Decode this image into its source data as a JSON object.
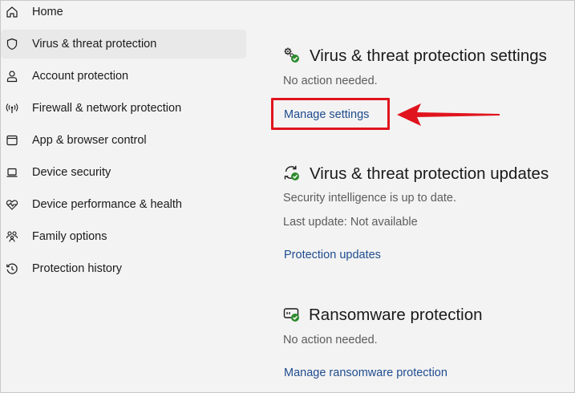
{
  "sidebar": {
    "items": [
      {
        "label": "Home",
        "icon": "home-icon"
      },
      {
        "label": "Virus & threat protection",
        "icon": "shield-icon",
        "selected": true
      },
      {
        "label": "Account protection",
        "icon": "person-icon"
      },
      {
        "label": "Firewall & network protection",
        "icon": "antenna-icon"
      },
      {
        "label": "App & browser control",
        "icon": "app-window-icon"
      },
      {
        "label": "Device security",
        "icon": "laptop-icon"
      },
      {
        "label": "Device performance & health",
        "icon": "heartbeat-icon"
      },
      {
        "label": "Family options",
        "icon": "family-icon"
      },
      {
        "label": "Protection history",
        "icon": "history-icon"
      }
    ]
  },
  "main": {
    "settings": {
      "title": "Virus & threat protection settings",
      "status": "No action needed.",
      "link": "Manage settings",
      "icon": "gear-check-icon"
    },
    "updates": {
      "title": "Virus & threat protection updates",
      "status": "Security intelligence is up to date.",
      "last_update": "Last update: Not available",
      "link": "Protection updates",
      "icon": "refresh-check-icon"
    },
    "ransomware": {
      "title": "Ransomware protection",
      "status": "No action needed.",
      "link": "Manage ransomware protection",
      "icon": "drive-check-icon"
    }
  },
  "colors": {
    "link": "#1f4c8f",
    "highlight": "#e0141e",
    "check_green": "#2e8b2e",
    "selected_bg": "#e9e9e9"
  }
}
